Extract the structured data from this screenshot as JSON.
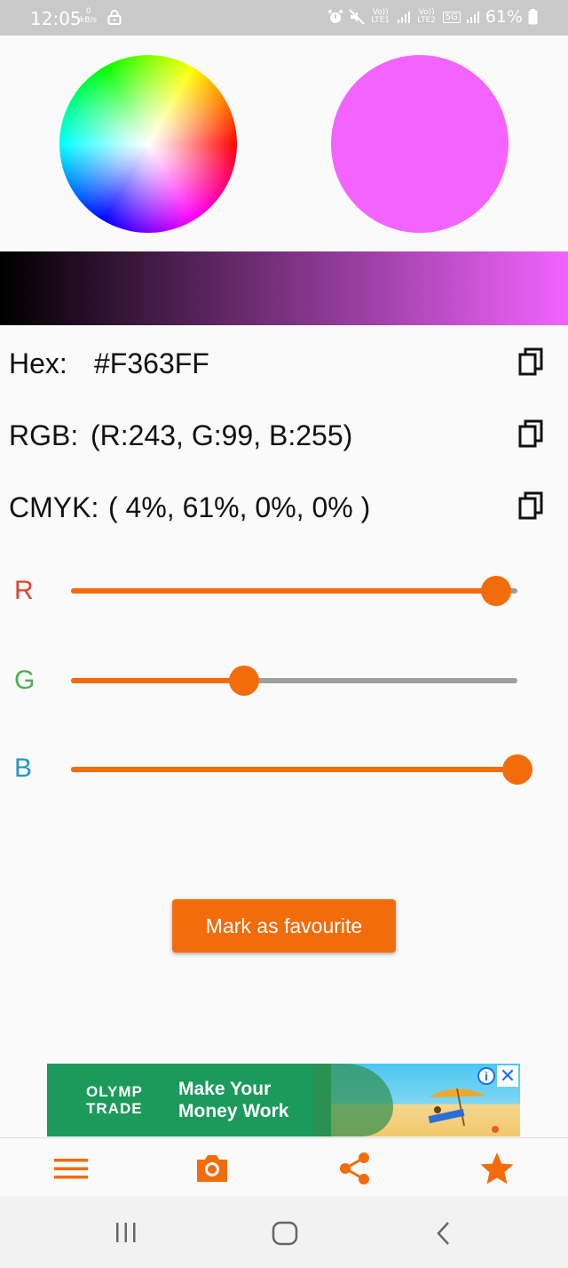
{
  "status_bar": {
    "time": "12:05",
    "net_speed_value": "0",
    "net_speed_unit": "kB/s",
    "sim1": "Vo)) LTE1",
    "sim2": "Vo)) LTE2",
    "network": "5G",
    "battery": "61%"
  },
  "color": {
    "hex_label": "Hex:",
    "hex_value": "#F363FF",
    "rgb_label": "RGB:",
    "rgb_value": "(R:243, G:99, B:255)",
    "cmyk_label": "CMYK:",
    "cmyk_value": "( 4%, 61%, 0%, 0% )",
    "swatch": "#F363FF"
  },
  "sliders": {
    "r_label": "R",
    "g_label": "G",
    "b_label": "B",
    "r_value": 243,
    "g_value": 99,
    "b_value": 255,
    "max": 255,
    "r_color": "#e0442f",
    "g_color": "#4caf50",
    "b_color": "#2196c9"
  },
  "favourite_button": "Mark as favourite",
  "ad": {
    "logo_line1": "OLYMP",
    "logo_line2": "TRADE",
    "headline_line1": "Make Your",
    "headline_line2": "Money Work",
    "info": "i",
    "close": "✕"
  },
  "toolbar": {
    "icons": [
      "menu-icon",
      "camera-icon",
      "share-icon",
      "star-icon"
    ],
    "accent": "#f26c0c"
  },
  "nav": {
    "icons": [
      "recent-apps-icon",
      "home-icon",
      "back-icon"
    ]
  }
}
